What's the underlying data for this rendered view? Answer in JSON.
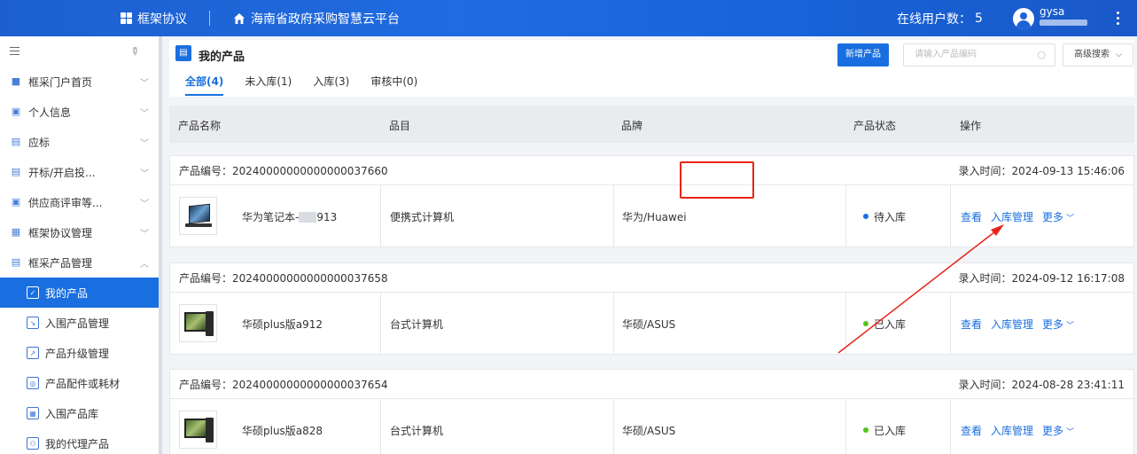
{
  "topbar": {
    "app_label": "框架协议",
    "platform_title": "海南省政府采购智慧云平台",
    "online_users_label": "在线用户数：",
    "online_users_count": "5",
    "username": "gysa"
  },
  "sidebar": {
    "items": [
      {
        "label": "框采门户首页",
        "icon": "apps-icon"
      },
      {
        "label": "个人信息",
        "icon": "id-card-icon"
      },
      {
        "label": "应标",
        "icon": "bid-icon"
      },
      {
        "label": "开标/开启投...",
        "icon": "open-bid-icon"
      },
      {
        "label": "供应商评审等...",
        "icon": "review-icon"
      },
      {
        "label": "框架协议管理",
        "icon": "agreement-icon"
      },
      {
        "label": "框采产品管理",
        "icon": "product-mgmt-icon"
      }
    ],
    "sub_items": [
      {
        "label": "我的产品",
        "icon": "my-product-icon"
      },
      {
        "label": "入围产品管理",
        "icon": "shortlist-icon"
      },
      {
        "label": "产品升级管理",
        "icon": "upgrade-icon"
      },
      {
        "label": "产品配件或耗材",
        "icon": "parts-icon"
      },
      {
        "label": "入围产品库",
        "icon": "library-icon"
      },
      {
        "label": "我的代理产品",
        "icon": "agent-icon"
      }
    ]
  },
  "main": {
    "page_title": "我的产品",
    "new_button": "新增产品",
    "search_placeholder": "请输入产品编码",
    "advanced_search": "高级搜索",
    "tabs": [
      {
        "label": "全部(4)"
      },
      {
        "label": "未入库(1)"
      },
      {
        "label": "入库(3)"
      },
      {
        "label": "审核中(0)"
      }
    ],
    "columns": [
      "产品名称",
      "品目",
      "品牌",
      "产品状态",
      "操作"
    ],
    "product_code_label": "产品编号：",
    "entry_time_label": "录入时间：",
    "actions": {
      "view": "查看",
      "manage": "入库管理",
      "more": "更多"
    },
    "products": [
      {
        "code": "20240000000000000037660",
        "entry_time": "2024-09-13 15:46:06",
        "name_prefix": "华为笔记本-",
        "name_suffix": "913",
        "category": "便携式计算机",
        "brand": "华为/Huawei",
        "status": "待入库",
        "status_color": "#1a6fe0",
        "thumb": "laptop"
      },
      {
        "code": "20240000000000000037658",
        "entry_time": "2024-09-12 16:17:08",
        "name": "华硕plus版a912",
        "category": "台式计算机",
        "brand": "华硕/ASUS",
        "status": "已入库",
        "status_color": "#52c41a",
        "thumb": "desktop"
      },
      {
        "code": "20240000000000000037654",
        "entry_time": "2024-08-28 23:41:11",
        "name": "华硕plus版a828",
        "category": "台式计算机",
        "brand": "华硕/ASUS",
        "status": "已入库",
        "status_color": "#52c41a",
        "thumb": "desktop"
      }
    ]
  },
  "colors": {
    "primary": "#1a6fe0",
    "highlight": "#e8231a",
    "topbar": "#1d62d6"
  }
}
